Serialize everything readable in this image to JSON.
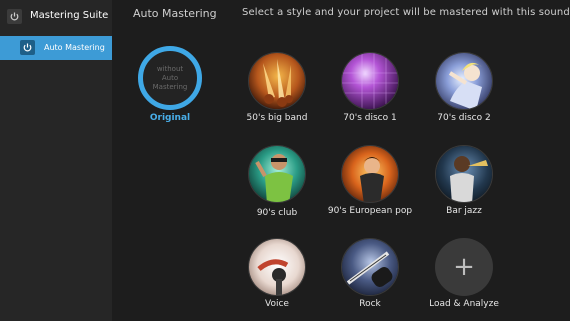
{
  "app": {
    "title": "Mastering Suite",
    "icon": "power-icon"
  },
  "sidebar": {
    "items": [
      {
        "label": "Auto Mastering",
        "icon": "power-icon",
        "selected": true
      }
    ]
  },
  "main": {
    "title": "Auto Mastering",
    "instruction": "Select a style and your project will be mastered with this sound:",
    "original": {
      "inner_text": "without Auto Mastering",
      "label": "Original"
    },
    "styles": [
      {
        "label": "50's big band",
        "image": "saxophones"
      },
      {
        "label": "70's disco 1",
        "image": "disco-ball"
      },
      {
        "label": "70's disco 2",
        "image": "disco-dancer"
      },
      {
        "label": "90's club",
        "image": "club-dancer"
      },
      {
        "label": "90's European pop",
        "image": "pop-singer"
      },
      {
        "label": "Bar jazz",
        "image": "trumpet-player"
      },
      {
        "label": "Voice",
        "image": "microphone"
      },
      {
        "label": "Rock",
        "image": "electric-guitar"
      }
    ],
    "load_analyze": {
      "label": "Load & Analyze",
      "icon": "plus-icon"
    }
  },
  "colors": {
    "accent": "#3fa8e6",
    "background": "#1d1d1d",
    "sidebar": "#262626",
    "selected_nav": "#3d9bd6"
  }
}
